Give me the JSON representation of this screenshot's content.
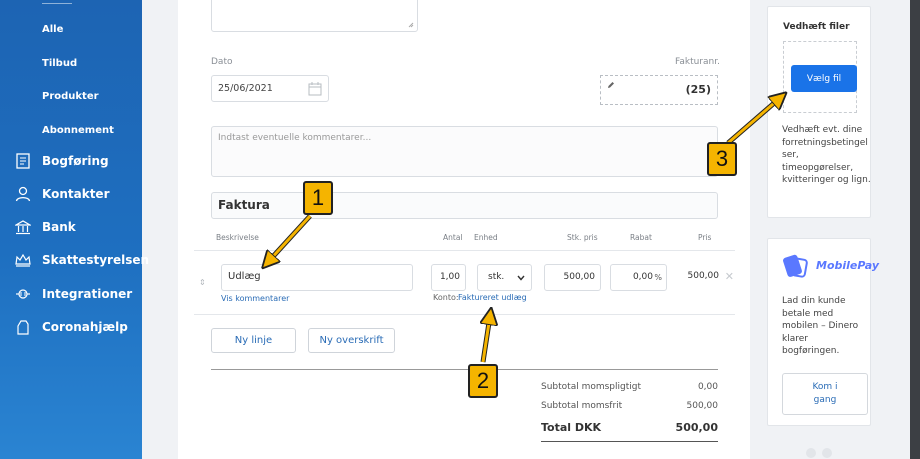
{
  "sidebar": {
    "sub_items": [
      "Alle",
      "Tilbud",
      "Produkter",
      "Abonnement"
    ],
    "main_items": [
      {
        "label": "Bogføring",
        "icon": "ledger-icon"
      },
      {
        "label": "Kontakter",
        "icon": "user-icon"
      },
      {
        "label": "Bank",
        "icon": "bank-icon"
      },
      {
        "label": "Skattestyrelsen",
        "icon": "crown-icon"
      },
      {
        "label": "Integrationer",
        "icon": "plugin-icon"
      },
      {
        "label": "Coronahjælp",
        "icon": "hand-icon"
      }
    ]
  },
  "form": {
    "date_label": "Dato",
    "date_value": "25/06/2021",
    "invoice_no_label": "Fakturanr.",
    "invoice_no_value": "(25)",
    "comments_placeholder": "Indtast eventuelle kommentarer...",
    "invoice_heading": "Faktura"
  },
  "table": {
    "headers": {
      "description": "Beskrivelse",
      "qty": "Antal",
      "unit": "Enhed",
      "unit_price": "Stk. pris",
      "discount": "Rabat",
      "price": "Pris"
    },
    "row": {
      "description": "Udlæg",
      "show_comments": "Vis kommentarer",
      "qty": "1,00",
      "unit": "stk.",
      "unit_price": "500,00",
      "discount": "0,00",
      "discount_unit": "%",
      "price": "500,00",
      "account_prefix": "Konto:",
      "account_link": "Faktureret udlæg"
    }
  },
  "buttons": {
    "new_line": "Ny linje",
    "new_heading": "Ny overskrift"
  },
  "totals": {
    "taxable_label": "Subtotal momspligtigt",
    "taxable_value": "0,00",
    "exempt_label": "Subtotal momsfrit",
    "exempt_value": "500,00",
    "total_label": "Total DKK",
    "total_value": "500,00"
  },
  "attach_card": {
    "title": "Vedhæft filer",
    "choose_button": "Vælg fil",
    "description": "Vedhæft evt. dine forretningsbetingelser, timeopgørelser, kvitteringer og lign."
  },
  "mobilepay_card": {
    "brand": "MobilePay",
    "text": "Lad din kunde betale med mobilen – Dinero klarer bogføringen.",
    "button": "Kom i gang"
  },
  "callouts": [
    "1",
    "2",
    "3"
  ],
  "colors": {
    "sidebar": "#1e6fc0",
    "accent": "#2a6cb6",
    "primary_button": "#1a73e8",
    "callout": "#f5b400",
    "mobilepay": "#5a78ff"
  }
}
